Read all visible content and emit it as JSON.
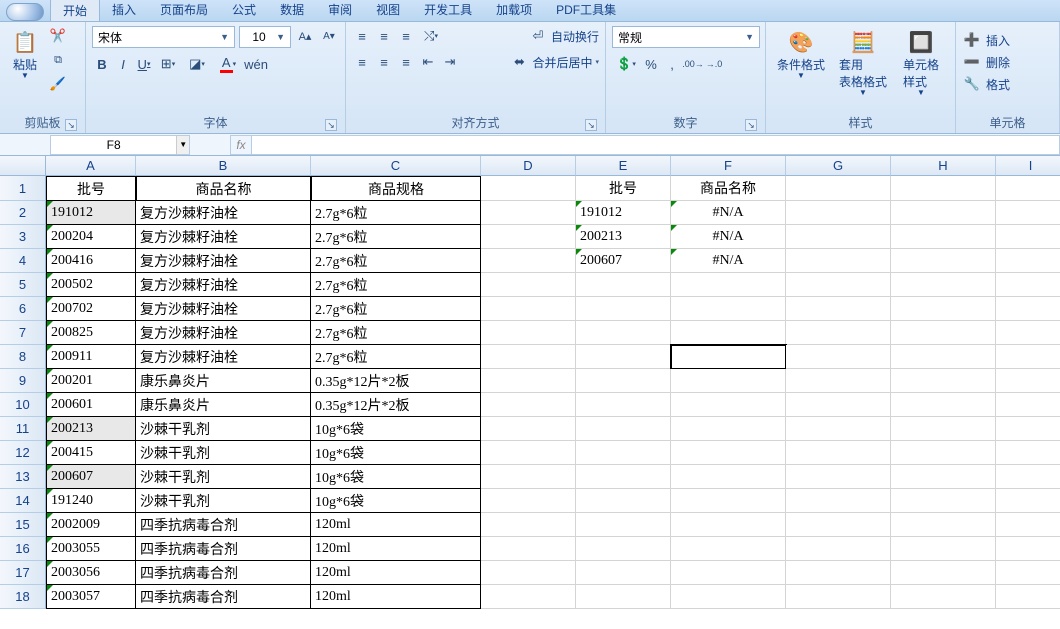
{
  "tabs": {
    "items": [
      "开始",
      "插入",
      "页面布局",
      "公式",
      "数据",
      "审阅",
      "视图",
      "开发工具",
      "加载项",
      "PDF工具集"
    ],
    "active": 0
  },
  "ribbon": {
    "clipboard": {
      "paste": "粘贴",
      "title": "剪贴板"
    },
    "font": {
      "title": "字体",
      "name": "宋体",
      "size": "10"
    },
    "alignment": {
      "title": "对齐方式",
      "wrap": "自动换行",
      "merge": "合并后居中"
    },
    "number": {
      "title": "数字",
      "format": "常规"
    },
    "styles": {
      "title": "样式",
      "cond": "条件格式",
      "tbl": "套用\n表格格式",
      "cell": "单元格\n样式"
    },
    "cells": {
      "title": "单元格",
      "insert": "插入",
      "delete": "删除",
      "format": "格式"
    }
  },
  "formula_bar": {
    "name_box": "F8",
    "fx": "fx"
  },
  "grid": {
    "col_widths": {
      "A": 90,
      "B": 175,
      "C": 170,
      "D": 95,
      "E": 95,
      "F": 115,
      "G": 105,
      "H": 105,
      "I": 70
    },
    "row_heights": {
      "header": 20,
      "1": 25,
      "default": 24
    },
    "columns": [
      "A",
      "B",
      "C",
      "D",
      "E",
      "F",
      "G",
      "H",
      "I"
    ],
    "rows": 18,
    "selection": "F8",
    "highlighted_cells": [
      "A2",
      "A11",
      "A13"
    ],
    "lookup": {
      "header": [
        "批号",
        "商品名称"
      ],
      "rows": [
        {
          "pn": "191012",
          "name": "#N/A"
        },
        {
          "pn": "200213",
          "name": "#N/A"
        },
        {
          "pn": "200607",
          "name": "#N/A"
        }
      ]
    },
    "main": {
      "header": [
        "批号",
        "商品名称",
        "商品规格"
      ],
      "rows": [
        {
          "pn": "191012",
          "name": "复方沙棘籽油栓",
          "spec": "2.7g*6粒"
        },
        {
          "pn": "200204",
          "name": "复方沙棘籽油栓",
          "spec": "2.7g*6粒"
        },
        {
          "pn": "200416",
          "name": "复方沙棘籽油栓",
          "spec": "2.7g*6粒"
        },
        {
          "pn": "200502",
          "name": "复方沙棘籽油栓",
          "spec": "2.7g*6粒"
        },
        {
          "pn": "200702",
          "name": "复方沙棘籽油栓",
          "spec": "2.7g*6粒"
        },
        {
          "pn": "200825",
          "name": "复方沙棘籽油栓",
          "spec": "2.7g*6粒"
        },
        {
          "pn": "200911",
          "name": "复方沙棘籽油栓",
          "spec": "2.7g*6粒"
        },
        {
          "pn": "200201",
          "name": "康乐鼻炎片",
          "spec": "0.35g*12片*2板"
        },
        {
          "pn": "200601",
          "name": "康乐鼻炎片",
          "spec": "0.35g*12片*2板"
        },
        {
          "pn": "200213",
          "name": "沙棘干乳剂",
          "spec": "10g*6袋"
        },
        {
          "pn": "200415",
          "name": "沙棘干乳剂",
          "spec": "10g*6袋"
        },
        {
          "pn": "200607",
          "name": "沙棘干乳剂",
          "spec": "10g*6袋"
        },
        {
          "pn": "191240",
          "name": "沙棘干乳剂",
          "spec": "10g*6袋"
        },
        {
          "pn": "2002009",
          "name": "四季抗病毒合剂",
          "spec": "120ml"
        },
        {
          "pn": "2003055",
          "name": "四季抗病毒合剂",
          "spec": "120ml"
        },
        {
          "pn": "2003056",
          "name": "四季抗病毒合剂",
          "spec": "120ml"
        },
        {
          "pn": "2003057",
          "name": "四季抗病毒合剂",
          "spec": "120ml"
        }
      ]
    }
  }
}
